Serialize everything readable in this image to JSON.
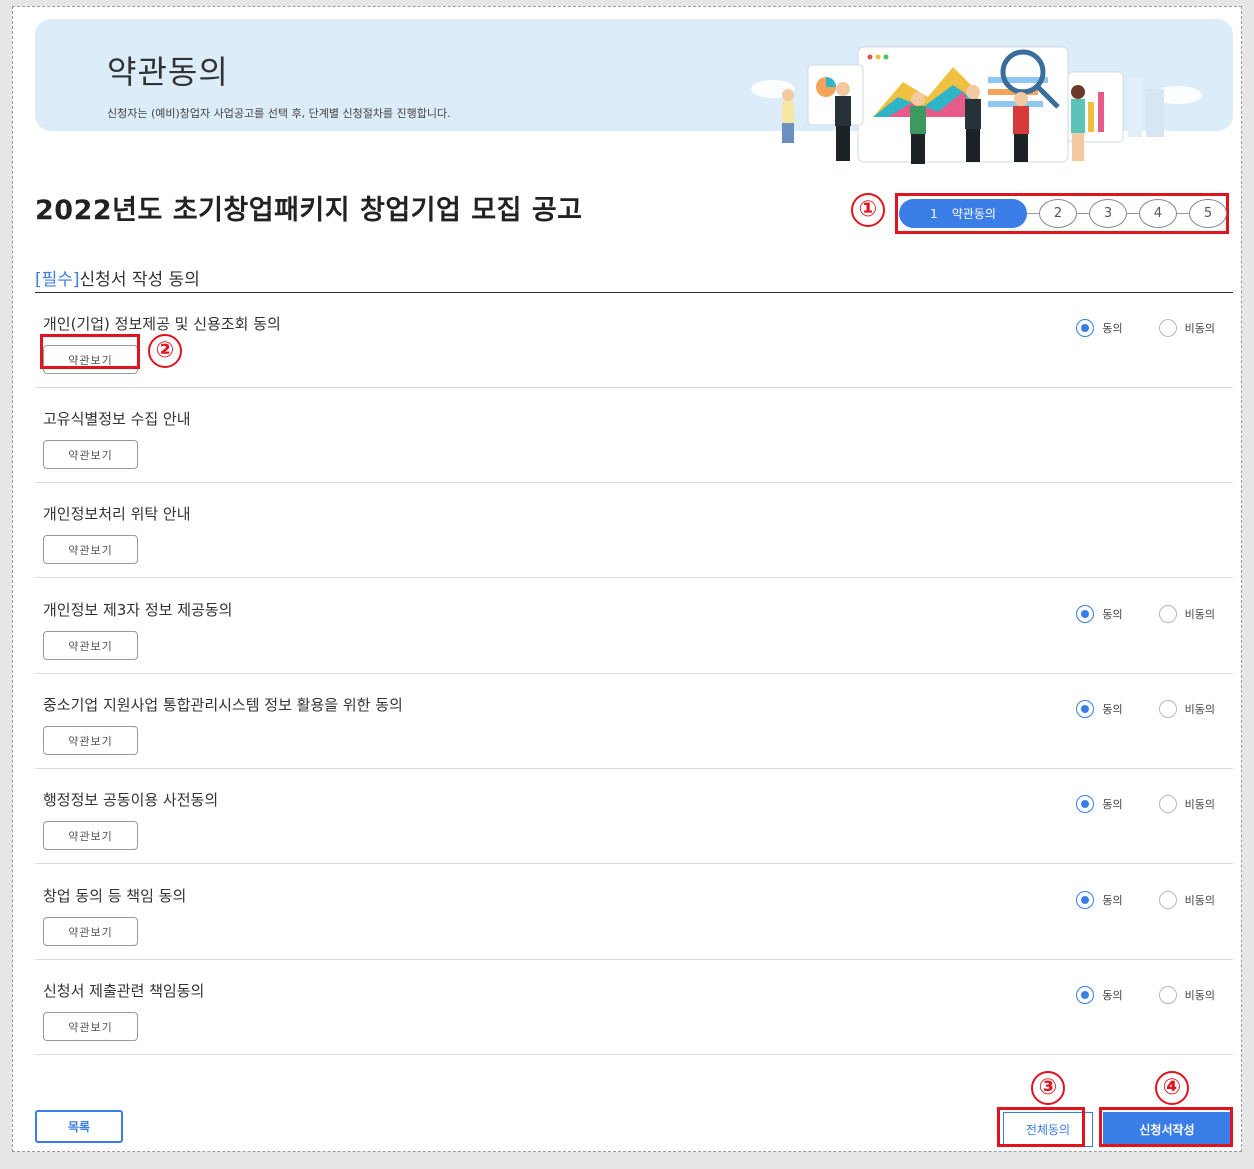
{
  "banner": {
    "title": "약관동의",
    "subtitle": "신청자는 (예비)창업자 사업공고를 선택 후, 단계별 신청절차를 진행합니다."
  },
  "notice_title": "2022년도 초기창업패키지 창업기업 모집 공고",
  "steps": {
    "active_num": "1",
    "active_label": "약관동의",
    "others": [
      "2",
      "3",
      "4",
      "5"
    ]
  },
  "section": {
    "tag": "[필수]",
    "title": "신청서 작성 동의"
  },
  "view_button_label": "약관보기",
  "radio_labels": {
    "agree": "동의",
    "disagree": "비동의"
  },
  "rows": [
    {
      "label": "개인(기업) 정보제공 및 신용조회 동의",
      "has_radio": true,
      "agreed": true
    },
    {
      "label": "고유식별정보 수집 안내",
      "has_radio": false
    },
    {
      "label": "개인정보처리 위탁 안내",
      "has_radio": false
    },
    {
      "label": "개인정보 제3자 정보 제공동의",
      "has_radio": true,
      "agreed": true
    },
    {
      "label": "중소기업 지원사업 통합관리시스템 정보 활용을 위한 동의",
      "has_radio": true,
      "agreed": true
    },
    {
      "label": "행정정보 공동이용 사전동의",
      "has_radio": true,
      "agreed": true
    },
    {
      "label": "창업 동의 등 책임 동의",
      "has_radio": true,
      "agreed": true
    },
    {
      "label": "신청서 제출관련 책임동의",
      "has_radio": true,
      "agreed": true
    }
  ],
  "annotations": {
    "m1": "①",
    "m2": "②",
    "m3": "③",
    "m4": "④"
  },
  "footer": {
    "list_label": "목록",
    "agree_all_label": "전체동의",
    "write_label": "신청서작성"
  },
  "colors": {
    "accent": "#3b7de6",
    "annotation": "#e0141e",
    "banner": "#dcecf8"
  }
}
